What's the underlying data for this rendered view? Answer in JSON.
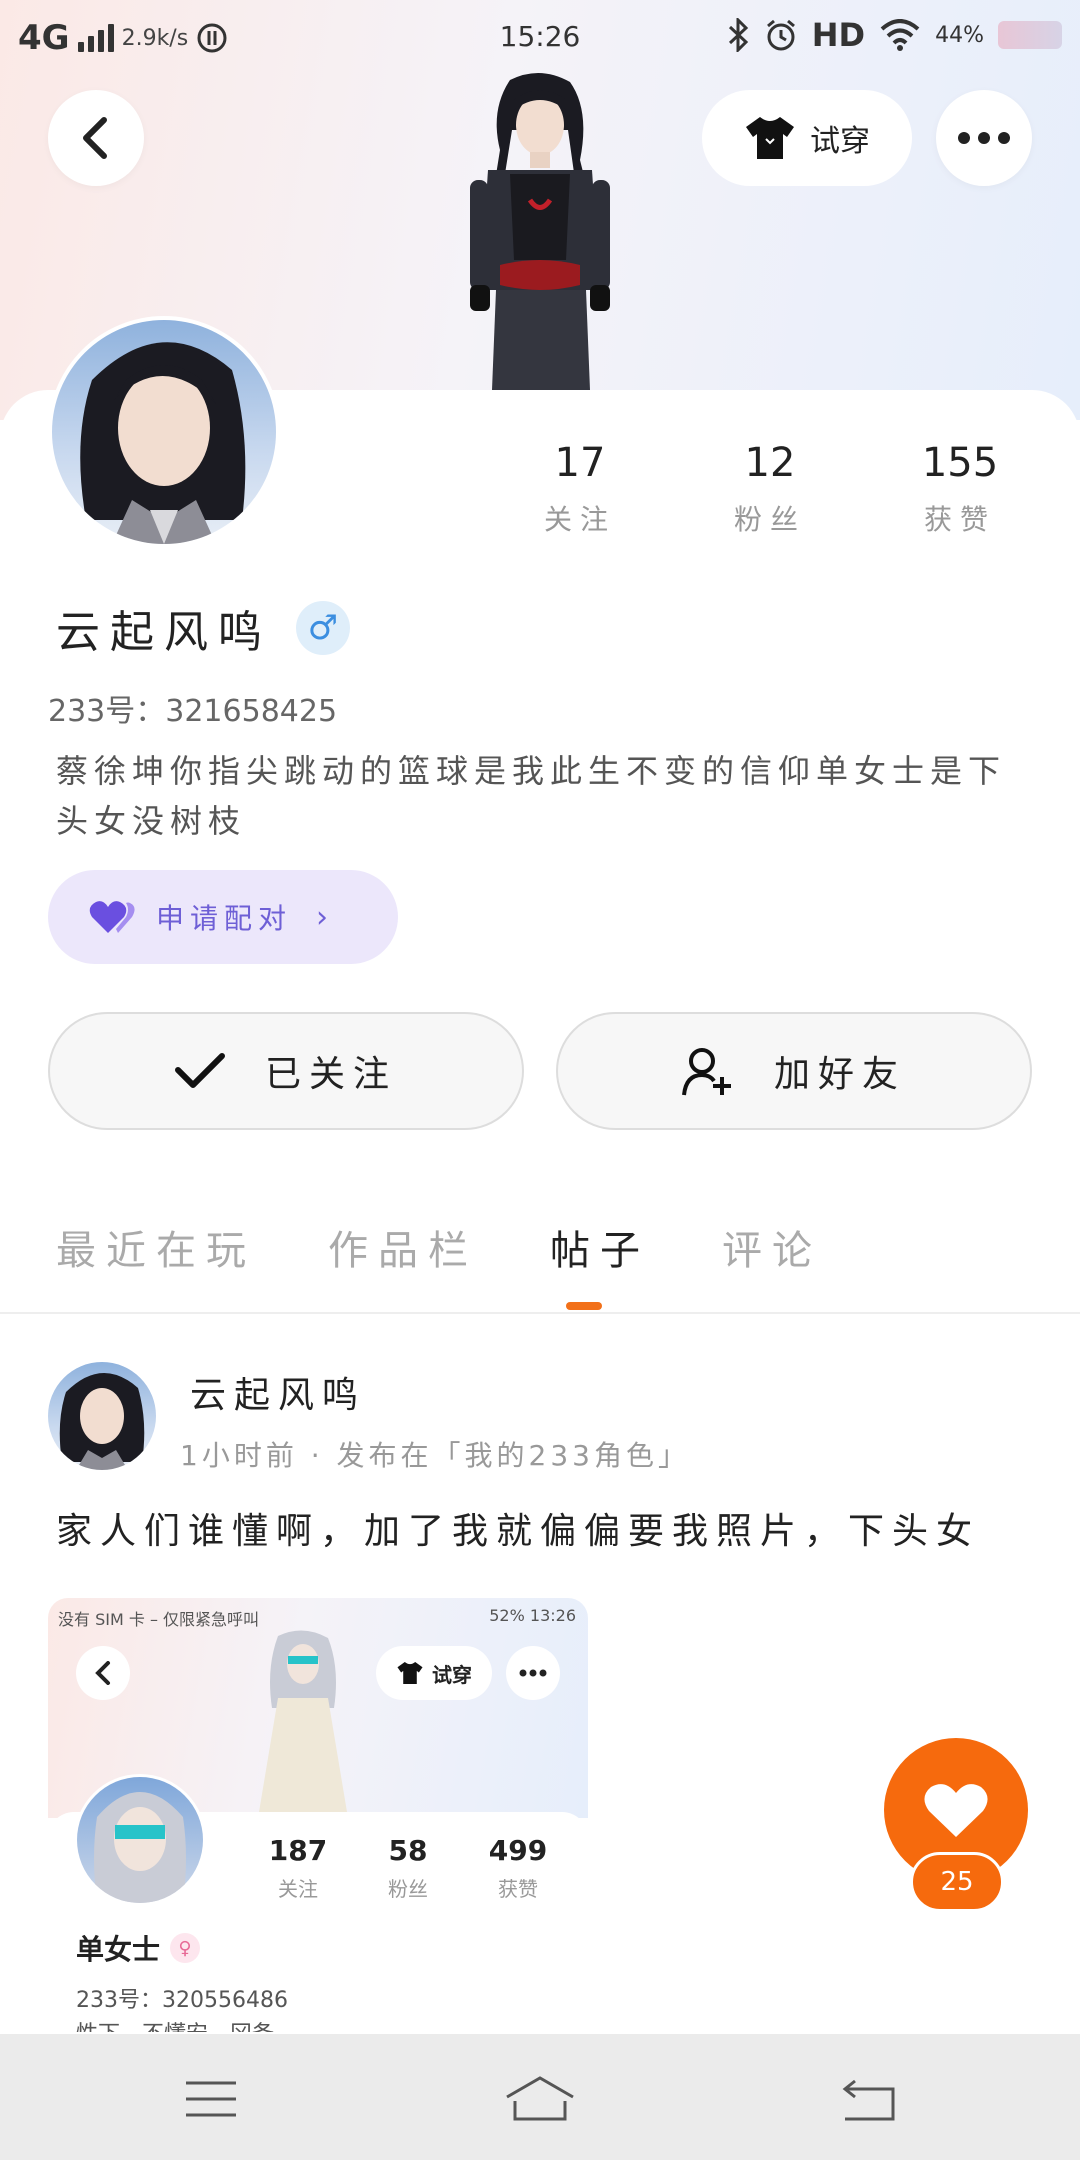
{
  "status_bar": {
    "network": "4G",
    "speed": "2.9k/s",
    "time": "15:26",
    "hd": "HD",
    "battery_text": "44%"
  },
  "header": {
    "tryon_label": "试穿"
  },
  "profile": {
    "name": "云起风鸣",
    "gender_symbol": "♂",
    "uid": "233号：321658425",
    "bio": "蔡徐坤你指尖跳动的篮球是我此生不变的信仰单女士是下头女没树枝",
    "stats": [
      {
        "value": "17",
        "label": "关注"
      },
      {
        "value": "12",
        "label": "粉丝"
      },
      {
        "value": "155",
        "label": "获赞"
      }
    ],
    "pair_label": "申请配对",
    "follow_label": "已关注",
    "add_friend_label": "加好友"
  },
  "tabs": [
    "最近在玩",
    "作品栏",
    "帖子",
    "评论"
  ],
  "active_tab_index": 2,
  "post": {
    "author": "云起风鸣",
    "meta": "1小时前 · 发布在「我的233角色」",
    "text": "家人们谁懂啊，加了我就偏偏要我照片，下头女",
    "like_count": "25",
    "embedded": {
      "status_left": "没有 SIM 卡 – 仅限紧急呼叫",
      "status_right": "52%  13:26",
      "tryon_label": "试穿",
      "stats": [
        {
          "value": "187",
          "label": "关注"
        },
        {
          "value": "58",
          "label": "粉丝"
        },
        {
          "value": "499",
          "label": "获赞"
        }
      ],
      "name": "单女士",
      "gender_symbol": "♀",
      "uid": "233号：320556486",
      "bio_partial": "性下…不懂安…冈备"
    }
  },
  "colors": {
    "accent": "#f27019",
    "like": "#f66a0d",
    "pair_bg": "#ece7fb",
    "pair_text": "#6e5fd6",
    "male_badge": "#3b8ee0"
  }
}
